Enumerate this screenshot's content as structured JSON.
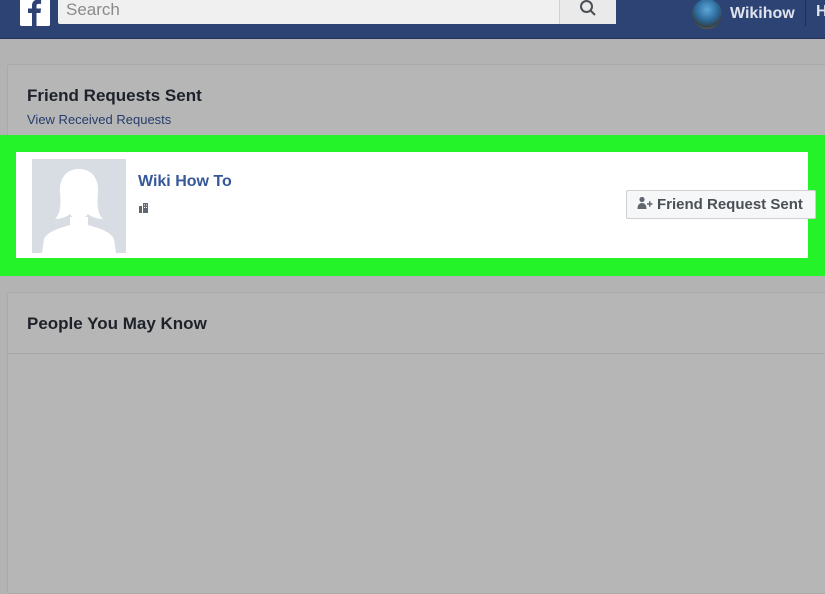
{
  "header": {
    "logo_icon": "facebook-f-icon",
    "search": {
      "placeholder": "Search",
      "icon": "search-icon"
    },
    "profile_name": "Wikihow",
    "nav_home": "H"
  },
  "friend_requests_sent": {
    "title": "Friend Requests Sent",
    "view_received_link": "View Received Requests",
    "requests": [
      {
        "name": "Wiki How To",
        "avatar_icon": "default-profile-silhouette-icon",
        "sub_icon": "building-icon",
        "button_label": "Friend Request Sent",
        "button_icon": "person-add-icon"
      }
    ]
  },
  "people_you_may_know": {
    "title": "People You May Know"
  },
  "colors": {
    "header_bg": "#2d4373",
    "highlight": "#25f329",
    "link": "#365899",
    "page_bg": "#b3b3b3"
  }
}
